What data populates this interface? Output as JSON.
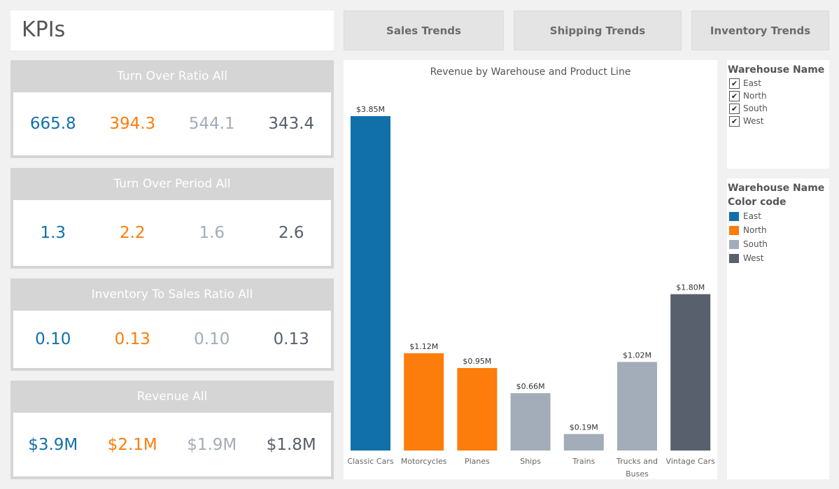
{
  "header": {
    "title": "KPIs"
  },
  "nav": [
    {
      "label": "Sales Trends"
    },
    {
      "label": "Shipping Trends"
    },
    {
      "label": "Inventory Trends"
    }
  ],
  "colors": {
    "East": "#1170aa",
    "North": "#fc7d0b",
    "South": "#a3acb9",
    "West": "#57606c"
  },
  "kpis": [
    {
      "title": "Turn Over Ratio All",
      "values": [
        "665.8",
        "394.3",
        "544.1",
        "343.4"
      ]
    },
    {
      "title": "Turn Over Period All",
      "values": [
        "1.3",
        "2.2",
        "1.6",
        "2.6"
      ]
    },
    {
      "title": "Inventory To Sales Ratio All",
      "values": [
        "0.10",
        "0.13",
        "0.10",
        "0.13"
      ]
    },
    {
      "title": "Revenue  All",
      "values": [
        "$3.9M",
        "$2.1M",
        "$1.9M",
        "$1.8M"
      ]
    }
  ],
  "filter": {
    "title": "Warehouse Name",
    "items": [
      {
        "label": "East",
        "checked": true
      },
      {
        "label": "North",
        "checked": true
      },
      {
        "label": "South",
        "checked": true
      },
      {
        "label": "West",
        "checked": true
      }
    ],
    "check_glyph": "✔"
  },
  "legend": {
    "title": "Warehouse Name",
    "subtitle": "Color code",
    "items": [
      {
        "label": "East",
        "color": "#1170aa"
      },
      {
        "label": "North",
        "color": "#fc7d0b"
      },
      {
        "label": "South",
        "color": "#a3acb9"
      },
      {
        "label": "West",
        "color": "#57606c"
      }
    ]
  },
  "chart_data": {
    "type": "bar",
    "title": "Revenue by Warehouse and Product Line",
    "xlabel": "",
    "ylabel": "",
    "ylim": [
      0,
      3.85
    ],
    "categories": [
      "Classic Cars",
      "Motorcycles",
      "Planes",
      "Ships",
      "Trains",
      "Trucks and Buses",
      "Vintage Cars"
    ],
    "category_lines": [
      [
        "Classic Cars"
      ],
      [
        "Motorcycles"
      ],
      [
        "Planes"
      ],
      [
        "Ships"
      ],
      [
        "Trains"
      ],
      [
        "Trucks and",
        "Buses"
      ],
      [
        "Vintage Cars"
      ]
    ],
    "values": [
      3.85,
      1.12,
      0.95,
      0.66,
      0.19,
      1.02,
      1.8
    ],
    "value_labels": [
      "$3.85M",
      "$1.12M",
      "$0.95M",
      "$0.66M",
      "$0.19M",
      "$1.02M",
      "$1.80M"
    ],
    "warehouse": [
      "East",
      "North",
      "North",
      "South",
      "South",
      "South",
      "West"
    ],
    "grid": false
  }
}
